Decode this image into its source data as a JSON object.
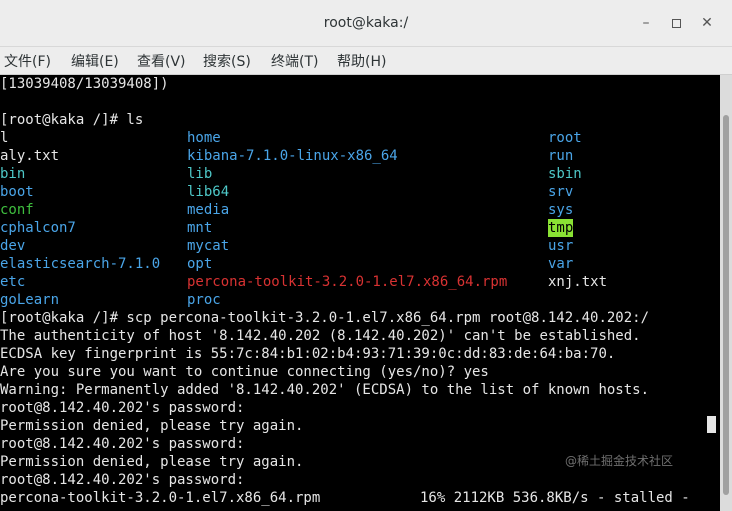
{
  "window": {
    "title": "root@kaka:/",
    "minimize_glyph": "–",
    "close_glyph": "✕"
  },
  "menu": {
    "items": [
      "文件(F)",
      "编辑(E)",
      "查看(V)",
      "搜索(S)",
      "终端(T)",
      "帮助(H)"
    ]
  },
  "terminal": {
    "lines": {
      "l0": "[13039408/13039408])",
      "l2": "[root@kaka /]# ls",
      "l15": "[root@kaka /]# scp percona-toolkit-3.2.0-1.el7.x86_64.rpm root@8.142.40.202:/",
      "l16": "The authenticity of host '8.142.40.202 (8.142.40.202)' can't be established.",
      "l17": "ECDSA key fingerprint is 55:7c:84:b1:02:b4:93:71:39:0c:dd:83:de:64:ba:70.",
      "l18": "Are you sure you want to continue connecting (yes/no)? yes",
      "l19": "Warning: Permanently added '8.142.40.202' (ECDSA) to the list of known hosts.",
      "l20": "root@8.142.40.202's password:",
      "l21": "Permission denied, please try again.",
      "l22": "root@8.142.40.202's password:",
      "l23": "Permission denied, please try again.",
      "l24": "root@8.142.40.202's password:",
      "l25a": "percona-toolkit-3.2.0-1.el7.x86_64.rpm",
      "l25b": "16% 2112KB 536.8KB/s - stalled -"
    },
    "ls": {
      "col1": [
        "l",
        "aly.txt",
        "bin",
        "boot",
        "conf",
        "cphalcon7",
        "dev",
        "elasticsearch-7.1.0",
        "etc",
        "goLearn"
      ],
      "col2": [
        "home",
        "kibana-7.1.0-linux-x86_64",
        "lib",
        "lib64",
        "media",
        "mnt",
        "mycat",
        "opt",
        "percona-toolkit-3.2.0-1.el7.x86_64.rpm",
        "proc"
      ],
      "col3": [
        "root",
        "run",
        "sbin",
        "srv",
        "sys",
        "tmp",
        "usr",
        "var",
        "xnj.txt"
      ]
    },
    "colors": {
      "directory": "#4aa5e8",
      "symlink": "#4ec8c8",
      "archive": "#d83232",
      "sticky_dir_bg": "#8ae234",
      "text": "#e6e6e6",
      "background": "#000000"
    }
  },
  "watermark": "@稀土掘金技术社区"
}
